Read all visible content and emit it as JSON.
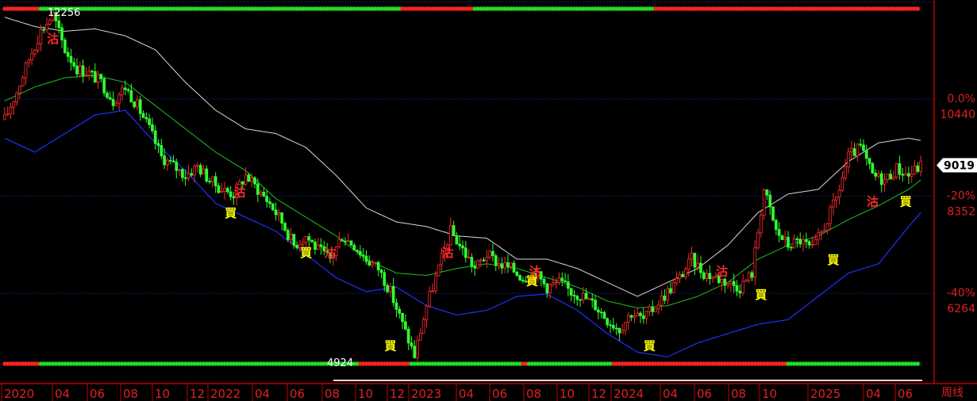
{
  "chart_data": {
    "type": "candlestick",
    "title": "",
    "timeframe_label": "周线",
    "x_tick_labels": [
      "2020",
      "04",
      "06",
      "08",
      "10",
      "12",
      "2022",
      "04",
      "06",
      "08",
      "10",
      "12",
      "2023",
      "04",
      "06",
      "08",
      "10",
      "12",
      "2024",
      "04",
      "06",
      "08",
      "10",
      "2025",
      "04",
      "06"
    ],
    "y_pct_labels": [
      "0.0%",
      "-20%",
      "-40%"
    ],
    "y_price_labels": [
      "10440",
      "8352",
      "6264"
    ],
    "current_price_label": "9019",
    "high_label": "12256",
    "low_label": "4924",
    "ylim": [
      4700,
      12400
    ],
    "price_points": [
      [
        0,
        10000
      ],
      [
        4,
        10600
      ],
      [
        8,
        11300
      ],
      [
        12,
        11900
      ],
      [
        16,
        12256
      ],
      [
        20,
        11500
      ],
      [
        24,
        11100
      ],
      [
        28,
        11000
      ],
      [
        32,
        10800
      ],
      [
        36,
        10400
      ],
      [
        40,
        10700
      ],
      [
        44,
        10300
      ],
      [
        48,
        9800
      ],
      [
        52,
        9200
      ],
      [
        56,
        9000
      ],
      [
        60,
        8800
      ],
      [
        64,
        9000
      ],
      [
        68,
        8700
      ],
      [
        72,
        8500
      ],
      [
        76,
        8400
      ],
      [
        80,
        8800
      ],
      [
        84,
        8500
      ],
      [
        88,
        8200
      ],
      [
        92,
        7800
      ],
      [
        96,
        7300
      ],
      [
        100,
        7500
      ],
      [
        104,
        7200
      ],
      [
        108,
        7000
      ],
      [
        112,
        7500
      ],
      [
        116,
        7300
      ],
      [
        120,
        7000
      ],
      [
        124,
        6800
      ],
      [
        128,
        6300
      ],
      [
        132,
        5600
      ],
      [
        136,
        4924
      ],
      [
        140,
        6000
      ],
      [
        144,
        6800
      ],
      [
        148,
        7600
      ],
      [
        152,
        7200
      ],
      [
        156,
        6800
      ],
      [
        160,
        7100
      ],
      [
        164,
        6900
      ],
      [
        168,
        6800
      ],
      [
        172,
        6600
      ],
      [
        176,
        6700
      ],
      [
        180,
        6400
      ],
      [
        184,
        6500
      ],
      [
        188,
        6300
      ],
      [
        192,
        6200
      ],
      [
        196,
        6000
      ],
      [
        200,
        5700
      ],
      [
        204,
        5500
      ],
      [
        208,
        5850
      ],
      [
        212,
        5700
      ],
      [
        216,
        6000
      ],
      [
        220,
        6300
      ],
      [
        224,
        6600
      ],
      [
        228,
        7000
      ],
      [
        232,
        6700
      ],
      [
        236,
        6600
      ],
      [
        240,
        6500
      ],
      [
        244,
        6400
      ],
      [
        248,
        6700
      ],
      [
        252,
        8500
      ],
      [
        256,
        7600
      ],
      [
        260,
        7300
      ],
      [
        264,
        7400
      ],
      [
        268,
        7200
      ],
      [
        272,
        7700
      ],
      [
        276,
        8300
      ],
      [
        280,
        9200
      ],
      [
        284,
        9400
      ],
      [
        288,
        8800
      ],
      [
        292,
        8700
      ],
      [
        296,
        8950
      ],
      [
        300,
        8800
      ],
      [
        304,
        9019
      ]
    ],
    "ma_points": [
      [
        0,
        10400
      ],
      [
        10,
        10700
      ],
      [
        20,
        10900
      ],
      [
        30,
        10950
      ],
      [
        40,
        10800
      ],
      [
        50,
        10300
      ],
      [
        60,
        9800
      ],
      [
        70,
        9300
      ],
      [
        80,
        8900
      ],
      [
        90,
        8300
      ],
      [
        100,
        7900
      ],
      [
        110,
        7500
      ],
      [
        120,
        7000
      ],
      [
        130,
        6700
      ],
      [
        140,
        6650
      ],
      [
        150,
        6800
      ],
      [
        160,
        6900
      ],
      [
        170,
        6800
      ],
      [
        180,
        6600
      ],
      [
        190,
        6400
      ],
      [
        200,
        6100
      ],
      [
        210,
        5950
      ],
      [
        220,
        6000
      ],
      [
        230,
        6200
      ],
      [
        240,
        6500
      ],
      [
        250,
        7000
      ],
      [
        260,
        7300
      ],
      [
        270,
        7500
      ],
      [
        280,
        7850
      ],
      [
        290,
        8150
      ],
      [
        300,
        8500
      ],
      [
        304,
        8700
      ]
    ],
    "upper_band_points": [
      [
        0,
        12200
      ],
      [
        10,
        12000
      ],
      [
        20,
        11900
      ],
      [
        30,
        11950
      ],
      [
        40,
        11800
      ],
      [
        50,
        11500
      ],
      [
        60,
        10800
      ],
      [
        70,
        10200
      ],
      [
        80,
        9800
      ],
      [
        90,
        9700
      ],
      [
        100,
        9400
      ],
      [
        110,
        8800
      ],
      [
        120,
        8100
      ],
      [
        130,
        7800
      ],
      [
        140,
        7700
      ],
      [
        150,
        7500
      ],
      [
        160,
        7450
      ],
      [
        170,
        7000
      ],
      [
        180,
        7000
      ],
      [
        190,
        6800
      ],
      [
        200,
        6500
      ],
      [
        210,
        6200
      ],
      [
        220,
        6500
      ],
      [
        230,
        6800
      ],
      [
        240,
        7300
      ],
      [
        250,
        8000
      ],
      [
        260,
        8400
      ],
      [
        270,
        8500
      ],
      [
        280,
        9100
      ],
      [
        290,
        9500
      ],
      [
        300,
        9600
      ],
      [
        304,
        9550
      ]
    ],
    "lower_band_points": [
      [
        0,
        9600
      ],
      [
        10,
        9300
      ],
      [
        20,
        9700
      ],
      [
        30,
        10100
      ],
      [
        40,
        10200
      ],
      [
        50,
        9500
      ],
      [
        60,
        8900
      ],
      [
        70,
        8200
      ],
      [
        80,
        7900
      ],
      [
        90,
        7600
      ],
      [
        100,
        7100
      ],
      [
        110,
        6600
      ],
      [
        120,
        6300
      ],
      [
        130,
        6400
      ],
      [
        140,
        6000
      ],
      [
        150,
        5800
      ],
      [
        160,
        5900
      ],
      [
        170,
        6200
      ],
      [
        180,
        6250
      ],
      [
        190,
        5900
      ],
      [
        200,
        5400
      ],
      [
        210,
        5000
      ],
      [
        220,
        4900
      ],
      [
        230,
        5200
      ],
      [
        240,
        5400
      ],
      [
        250,
        5600
      ],
      [
        260,
        5700
      ],
      [
        270,
        6200
      ],
      [
        280,
        6700
      ],
      [
        290,
        6900
      ],
      [
        300,
        7700
      ],
      [
        304,
        8000
      ]
    ],
    "annotations": [
      {
        "text": "沽",
        "t": 16,
        "price": 11650,
        "color": "#ff2a2a"
      },
      {
        "text": "沽",
        "t": 78,
        "price": 8350,
        "color": "#ff2a2a"
      },
      {
        "text": "買",
        "t": 75,
        "price": 7900,
        "color": "#ffff00"
      },
      {
        "text": "買",
        "t": 100,
        "price": 7050,
        "color": "#ffff00"
      },
      {
        "text": "沽",
        "t": 108,
        "price": 7050,
        "color": "#ff2a2a"
      },
      {
        "text": "買",
        "t": 128,
        "price": 5050,
        "color": "#ffff00"
      },
      {
        "text": "沽",
        "t": 147,
        "price": 7050,
        "color": "#ff2a2a"
      },
      {
        "text": "買",
        "t": 175,
        "price": 6450,
        "color": "#ffff00"
      },
      {
        "text": "沽",
        "t": 176,
        "price": 6650,
        "color": "#ff2a2a"
      },
      {
        "text": "買",
        "t": 214,
        "price": 5050,
        "color": "#ffff00"
      },
      {
        "text": "沽",
        "t": 238,
        "price": 6650,
        "color": "#ff2a2a"
      },
      {
        "text": "買",
        "t": 251,
        "price": 6150,
        "color": "#ffff00"
      },
      {
        "text": "買",
        "t": 275,
        "price": 6900,
        "color": "#ffff00"
      },
      {
        "text": "沽",
        "t": 288,
        "price": 8150,
        "color": "#ff2a2a"
      },
      {
        "text": "買",
        "t": 299,
        "price": 8150,
        "color": "#ffff00"
      }
    ],
    "signal_colors": [
      "#ff2020",
      "#20e020"
    ],
    "top_signal_runs": [
      [
        0,
        "r",
        12
      ],
      [
        12,
        "g",
        120
      ],
      [
        132,
        "r",
        24
      ],
      [
        156,
        "g",
        60
      ],
      [
        216,
        "r",
        88
      ]
    ],
    "bottom_signal_runs": [
      [
        0,
        "r",
        12
      ],
      [
        12,
        "g",
        106
      ],
      [
        118,
        "r",
        17
      ],
      [
        135,
        "g",
        37
      ],
      [
        172,
        "r",
        2
      ],
      [
        174,
        "g",
        28
      ],
      [
        202,
        "r",
        58
      ],
      [
        260,
        "g",
        44
      ]
    ],
    "colors": {
      "up": "#ff2a2a",
      "down": "#30ff30",
      "ma": "#20c020",
      "upper_band": "#d8d8d8",
      "lower_band": "#2030ff",
      "grid": "#1e2a9a",
      "axis_text": "#e02020",
      "frame": "#c00000"
    }
  }
}
